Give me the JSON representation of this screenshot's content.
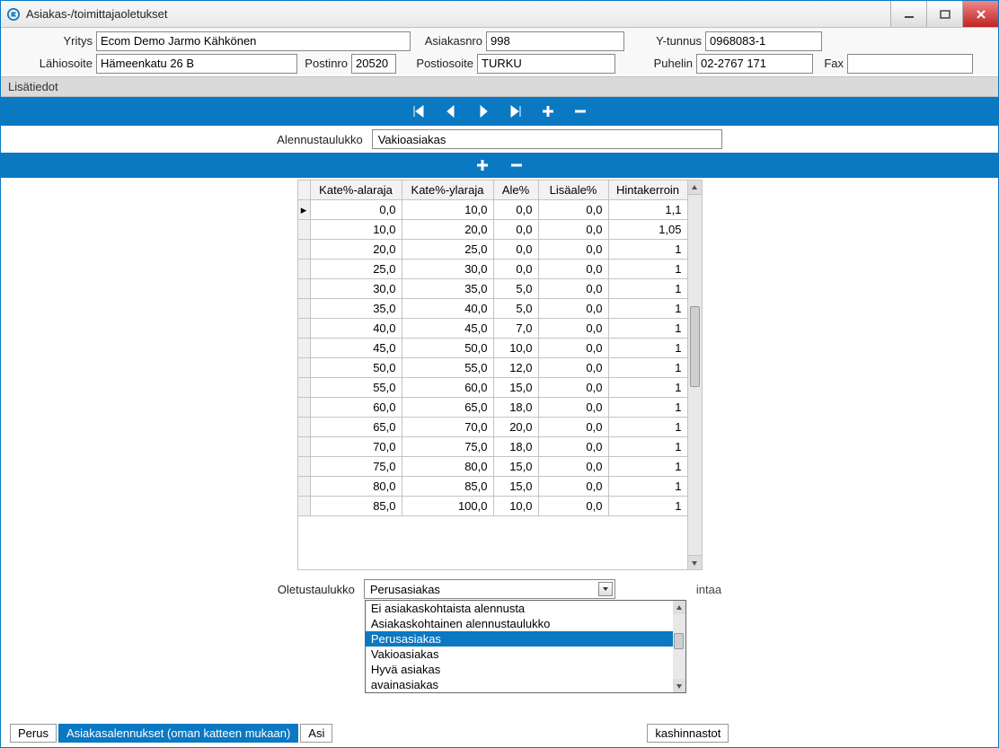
{
  "window": {
    "title": "Asiakas-/toimittajaoletukset"
  },
  "form": {
    "yritys_label": "Yritys",
    "yritys_value": "Ecom Demo Jarmo Kähkönen",
    "asiakasnro_label": "Asiakasnro",
    "asiakasnro_value": "998",
    "ytunnus_label": "Y-tunnus",
    "ytunnus_value": "0968083-1",
    "lahiosoite_label": "Lähiosoite",
    "lahiosoite_value": "Hämeenkatu 26 B",
    "postinro_label": "Postinro",
    "postinro_value": "20520",
    "postiosoite_label": "Postiosoite",
    "postiosoite_value": "TURKU",
    "puhelin_label": "Puhelin",
    "puhelin_value": "02-2767 171",
    "fax_label": "Fax",
    "fax_value": ""
  },
  "section1_label": "Lisätiedot",
  "alennustaulukko": {
    "label": "Alennustaulukko",
    "value": "Vakioasiakas"
  },
  "table": {
    "headers": {
      "h1": "Kate%-alaraja",
      "h2": "Kate%-ylaraja",
      "h3": "Ale%",
      "h4": "Lisäale%",
      "h5": "Hintakerroin"
    },
    "rows": [
      {
        "a": "0,0",
        "b": "10,0",
        "c": "0,0",
        "d": "0,0",
        "e": "1,1"
      },
      {
        "a": "10,0",
        "b": "20,0",
        "c": "0,0",
        "d": "0,0",
        "e": "1,05"
      },
      {
        "a": "20,0",
        "b": "25,0",
        "c": "0,0",
        "d": "0,0",
        "e": "1"
      },
      {
        "a": "25,0",
        "b": "30,0",
        "c": "0,0",
        "d": "0,0",
        "e": "1"
      },
      {
        "a": "30,0",
        "b": "35,0",
        "c": "5,0",
        "d": "0,0",
        "e": "1"
      },
      {
        "a": "35,0",
        "b": "40,0",
        "c": "5,0",
        "d": "0,0",
        "e": "1"
      },
      {
        "a": "40,0",
        "b": "45,0",
        "c": "7,0",
        "d": "0,0",
        "e": "1"
      },
      {
        "a": "45,0",
        "b": "50,0",
        "c": "10,0",
        "d": "0,0",
        "e": "1"
      },
      {
        "a": "50,0",
        "b": "55,0",
        "c": "12,0",
        "d": "0,0",
        "e": "1"
      },
      {
        "a": "55,0",
        "b": "60,0",
        "c": "15,0",
        "d": "0,0",
        "e": "1"
      },
      {
        "a": "60,0",
        "b": "65,0",
        "c": "18,0",
        "d": "0,0",
        "e": "1"
      },
      {
        "a": "65,0",
        "b": "70,0",
        "c": "20,0",
        "d": "0,0",
        "e": "1"
      },
      {
        "a": "70,0",
        "b": "75,0",
        "c": "18,0",
        "d": "0,0",
        "e": "1"
      },
      {
        "a": "75,0",
        "b": "80,0",
        "c": "15,0",
        "d": "0,0",
        "e": "1"
      },
      {
        "a": "80,0",
        "b": "85,0",
        "c": "15,0",
        "d": "0,0",
        "e": "1"
      },
      {
        "a": "85,0",
        "b": "100,0",
        "c": "10,0",
        "d": "0,0",
        "e": "1"
      }
    ]
  },
  "oletustaulukko": {
    "label": "Oletustaulukko",
    "value": "Perusasiakas",
    "options": [
      "Ei asiakaskohtaista alennusta",
      "Asiakaskohtainen alennustaulukko",
      "Perusasiakas",
      "Vakioasiakas",
      "Hyvä asiakas",
      "avainasiakas"
    ],
    "selected_index": 2
  },
  "hint_text_fragment": "intaa",
  "tabs": {
    "t0": "Perus",
    "t1": "Asiakasalennukset (oman katteen mukaan)",
    "t2_partial": "Asi",
    "t3_partial": "kashinnastot"
  }
}
